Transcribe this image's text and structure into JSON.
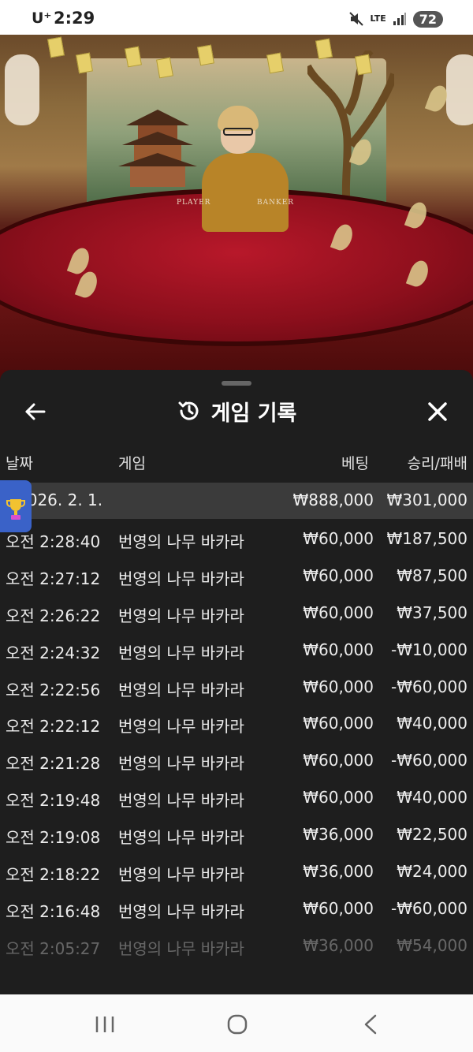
{
  "status_bar": {
    "carrier": "U⁺",
    "time": "2:29",
    "network": "LTE",
    "battery": "72",
    "icons": [
      "mute-icon",
      "signal-icon"
    ]
  },
  "video": {
    "table_labels": {
      "player": "PLAYER",
      "banker": "BANKER"
    }
  },
  "panel": {
    "title": "게임 기록",
    "icons": {
      "back": "arrow-left-icon",
      "title": "history-icon",
      "close": "close-icon"
    },
    "columns": {
      "date": "날짜",
      "game": "게임",
      "bet": "베팅",
      "result": "승리/패배"
    },
    "summary": {
      "date": "2026. 2. 1.",
      "bet": "₩888,000",
      "result": "₩301,000"
    },
    "rows": [
      {
        "time": "오전 2:28:40",
        "game": "번영의 나무 바카라",
        "bet": "₩60,000",
        "result": "₩187,500"
      },
      {
        "time": "오전 2:27:12",
        "game": "번영의 나무 바카라",
        "bet": "₩60,000",
        "result": "₩87,500"
      },
      {
        "time": "오전 2:26:22",
        "game": "번영의 나무 바카라",
        "bet": "₩60,000",
        "result": "₩37,500"
      },
      {
        "time": "오전 2:24:32",
        "game": "번영의 나무 바카라",
        "bet": "₩60,000",
        "result": "-₩10,000"
      },
      {
        "time": "오전 2:22:56",
        "game": "번영의 나무 바카라",
        "bet": "₩60,000",
        "result": "-₩60,000"
      },
      {
        "time": "오전 2:22:12",
        "game": "번영의 나무 바카라",
        "bet": "₩60,000",
        "result": "₩40,000"
      },
      {
        "time": "오전 2:21:28",
        "game": "번영의 나무 바카라",
        "bet": "₩60,000",
        "result": "-₩60,000"
      },
      {
        "time": "오전 2:19:48",
        "game": "번영의 나무 바카라",
        "bet": "₩60,000",
        "result": "₩40,000"
      },
      {
        "time": "오전 2:19:08",
        "game": "번영의 나무 바카라",
        "bet": "₩36,000",
        "result": "₩22,500"
      },
      {
        "time": "오전 2:18:22",
        "game": "번영의 나무 바카라",
        "bet": "₩36,000",
        "result": "₩24,000"
      },
      {
        "time": "오전 2:16:48",
        "game": "번영의 나무 바카라",
        "bet": "₩60,000",
        "result": "-₩60,000"
      },
      {
        "time": "오전 2:05:27",
        "game": "번영의 나무 바카라",
        "bet": "₩36,000",
        "result": "₩54,000"
      }
    ]
  },
  "nav_bar": {
    "icons": [
      "recents-icon",
      "home-icon",
      "back-icon"
    ]
  },
  "colors": {
    "panel_bg": "#1e1e1e",
    "summary_bg": "#3b3b3b",
    "felt_red": "#8c0f1c",
    "trophy_badge": "#3a62c8"
  }
}
